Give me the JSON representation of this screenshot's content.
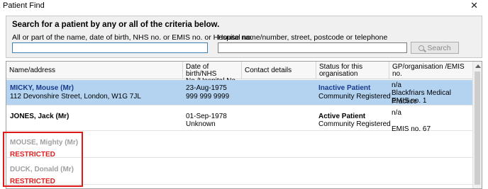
{
  "window": {
    "title": "Patient Find",
    "close_glyph": "✕"
  },
  "search": {
    "heading": "Search for a patient by any or all of the criteria below.",
    "label_name": "All or part of the name, date of birth, NHS no. or EMIS no. or Hospital no.",
    "label_address": "House name/number, street, postcode or telephone",
    "name_value": "",
    "address_value": "",
    "button_label": "Search"
  },
  "columns": [
    {
      "line1": "Name/address",
      "line2": ""
    },
    {
      "line1": "Date of birth/NHS",
      "line2": "No./Hospital No."
    },
    {
      "line1": "Contact details",
      "line2": ""
    },
    {
      "line1": "Status for this",
      "line2": "organisation"
    },
    {
      "line1": "GP/organisation /EMIS",
      "line2": "no."
    }
  ],
  "rows": [
    {
      "name": "MICKY, Mouse (Mr)",
      "address": "112 Devonshire Street, London, W1G 7JL",
      "dob": "23-Aug-1975",
      "nhs": "999 999 9999",
      "status": "Inactive Patient",
      "registration": "Community Registered",
      "gp_line1": "n/a",
      "gp_line2": "Blackfriars Medical Practice",
      "gp_line3": "EMIS no. 1"
    },
    {
      "name": "JONES, Jack (Mr)",
      "address": "",
      "dob": "01-Sep-1978",
      "nhs": "Unknown",
      "status": "Active Patient",
      "registration": "Community Registered",
      "gp_line1": "n/a",
      "gp_line2": "",
      "gp_line3": "EMIS no. 67"
    },
    {
      "name": "MOUSE, Mighty (Mr)",
      "restricted": "RESTRICTED"
    },
    {
      "name": "DUCK, Donald (Mr)",
      "restricted": "RESTRICTED"
    }
  ],
  "colors": {
    "selected_row": "#b3d3f1",
    "restricted": "#e02020",
    "highlight_box": "#e01818"
  }
}
